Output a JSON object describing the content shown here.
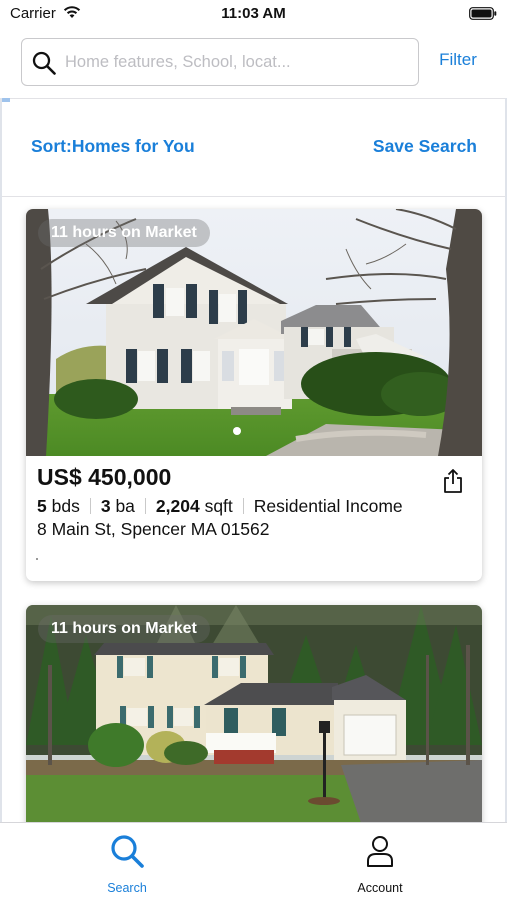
{
  "status_bar": {
    "carrier": "Carrier",
    "time": "11:03 AM",
    "icons": [
      "wifi-icon",
      "battery-icon"
    ]
  },
  "search": {
    "placeholder": "Home features, School, locat...",
    "value": "",
    "filter_label": "Filter",
    "icon": "search-icon"
  },
  "sort_bar": {
    "sort_label": "Sort:Homes for You",
    "save_search_label": "Save Search"
  },
  "listings": [
    {
      "market_badge": "11 hours on Market",
      "price": "US$ 450,000",
      "beds_value": "5",
      "beds_unit": "bds",
      "baths_value": "3",
      "baths_unit": "ba",
      "sqft_value": "2,204",
      "sqft_unit": "sqft",
      "property_type": "Residential Income",
      "address": "8 Main St, Spencer MA 01562",
      "photo_icon": "house-photo",
      "photo_page": 1
    },
    {
      "market_badge": "11 hours on Market",
      "photo_icon": "house-photo"
    }
  ],
  "tab_bar": {
    "tabs": [
      {
        "label": "Search",
        "icon": "search-icon",
        "selected": true
      },
      {
        "label": "Account",
        "icon": "person-icon",
        "selected": false
      }
    ]
  },
  "colors": {
    "accent": "#1a7fd9",
    "placeholder": "#bdbdc2",
    "divider": "#e2e2e6"
  }
}
